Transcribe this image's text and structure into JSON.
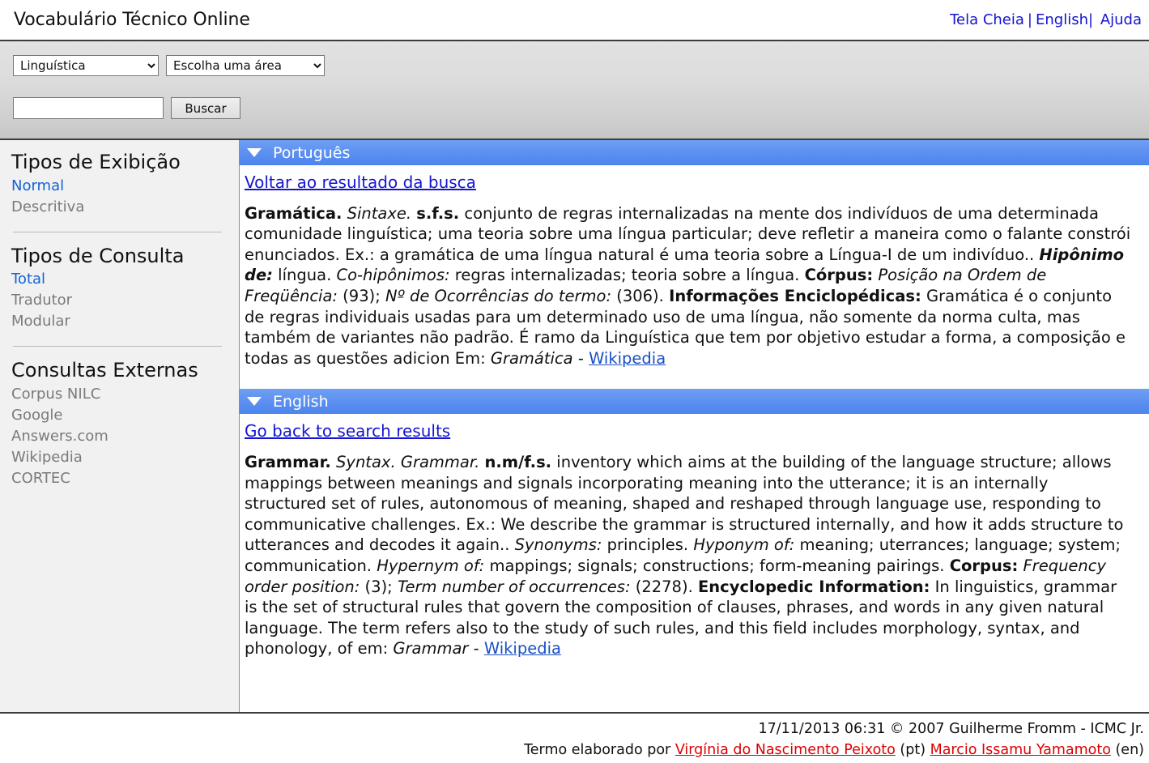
{
  "header": {
    "title": "Vocabulário Técnico Online",
    "links": [
      {
        "label": "Tela Cheia",
        "name": "fullscreen-link"
      },
      {
        "label": "English",
        "name": "english-link"
      },
      {
        "label": "Ajuda",
        "name": "help-link"
      }
    ],
    "separator": "|"
  },
  "toolbar": {
    "area_select": {
      "selected": "Linguística",
      "options": [
        "Linguística"
      ]
    },
    "domain_select": {
      "selected": "Escolha uma área",
      "options": [
        "Escolha uma área"
      ]
    },
    "search_input": {
      "value": "",
      "placeholder": ""
    },
    "search_button": "Buscar"
  },
  "sidebar": {
    "sections": [
      {
        "heading": "Tipos de Exibição",
        "items": [
          {
            "label": "Normal",
            "active": true
          },
          {
            "label": "Descritiva",
            "active": false
          }
        ]
      },
      {
        "heading": "Tipos de Consulta",
        "items": [
          {
            "label": "Total",
            "active": true
          },
          {
            "label": "Tradutor",
            "active": false
          },
          {
            "label": "Modular",
            "active": false
          }
        ]
      },
      {
        "heading": "Consultas Externas",
        "items": [
          {
            "label": "Corpus NILC",
            "active": false
          },
          {
            "label": "Google",
            "active": false
          },
          {
            "label": "Answers.com",
            "active": false
          },
          {
            "label": "Wikipedia",
            "active": false
          },
          {
            "label": "CORTEC",
            "active": false
          }
        ]
      }
    ]
  },
  "panels": {
    "portuguese": {
      "title": "Português",
      "back_link": "Voltar ao resultado da busca",
      "term": "Gramática.",
      "field": "Sintaxe.",
      "grammar_tag": "s.f.s.",
      "definition": " conjunto de regras internalizadas na mente dos indivíduos de uma determinada comunidade linguística; uma teoria sobre uma língua particular; deve refletir a maneira como o falante constrói enunciados. Ex.: a gramática de uma língua natural é uma teoria sobre a Língua-I de um indivíduo.. ",
      "rel1_label": "Hipônimo de:",
      "rel1_value": " língua. ",
      "rel2_label": "Co-hipônimos:",
      "rel2_value": " regras internalizadas; teoria sobre a língua. ",
      "corpus_label": "Córpus:",
      "freq_label": " Posição na Ordem de Freqüência:",
      "freq_value": " (93); ",
      "occ_label": "Nº de Ocorrências do termo:",
      "occ_value": " (306). ",
      "enc_label": "Informações Enciclopédicas:",
      "enc_value": " Gramática é o conjunto de regras individuais usadas para um determinado uso de uma língua, não somente da norma culta, mas também de variantes não padrão. É ramo da Linguística que tem por objetivo estudar a forma, a composição e todas as questões adicion Em: ",
      "source_term": "Gramática",
      "source_dash": " - ",
      "source_link": "Wikipedia"
    },
    "english": {
      "title": "English",
      "back_link": "Go back to search results",
      "term": "Grammar.",
      "field": "Syntax.",
      "subfield": "Grammar.",
      "grammar_tag": "n.m/f.s.",
      "definition": " inventory which aims at the building of the language structure; allows mappings between meanings and signals incorporating meaning into the utterance; it is an internally structured set of rules, autonomous of meaning, shaped and reshaped through language use, responding to communicative challenges. Ex.: We describe the grammar is structured internally, and how it adds structure to utterances and decodes it again.. ",
      "rel0_label": "Synonyms:",
      "rel0_value": " principles. ",
      "rel1_label": "Hyponym of:",
      "rel1_value": " meaning; uterrances; language; system; communication. ",
      "rel2_label": "Hypernym of:",
      "rel2_value": " mappings; signals; constructions; form-meaning pairings. ",
      "corpus_label": "Corpus:",
      "freq_label": " Frequency order position:",
      "freq_value": " (3); ",
      "occ_label": "Term number of occurrences:",
      "occ_value": " (2278). ",
      "enc_label": "Encyclopedic Information:",
      "enc_value": " In linguistics, grammar is the set of structural rules that govern the composition of clauses, phrases, and words in any given natural language. The term refers also to the study of such rules, and this field includes morphology, syntax, and phonology, of em: ",
      "source_term": "Grammar",
      "source_dash": " - ",
      "source_link": "Wikipedia"
    }
  },
  "footer": {
    "copyright": "17/11/2013 06:31 © 2007 Guilherme Fromm - ICMC Jr.",
    "credit_prefix": "Termo elaborado por ",
    "author_pt": "Virgínia do Nascimento Peixoto",
    "lang_pt": " (pt) ",
    "author_en": "Marcio Issamu Yamamoto",
    "lang_en": " (en)"
  },
  "colors": {
    "panel_header_blue": "#5b8ff0",
    "link_blue": "#1414d2",
    "active_blue": "#1562d6",
    "muted_gray": "#7a7a7a",
    "credit_red": "#dd0000",
    "sidebar_bg": "#f1f1f1"
  }
}
